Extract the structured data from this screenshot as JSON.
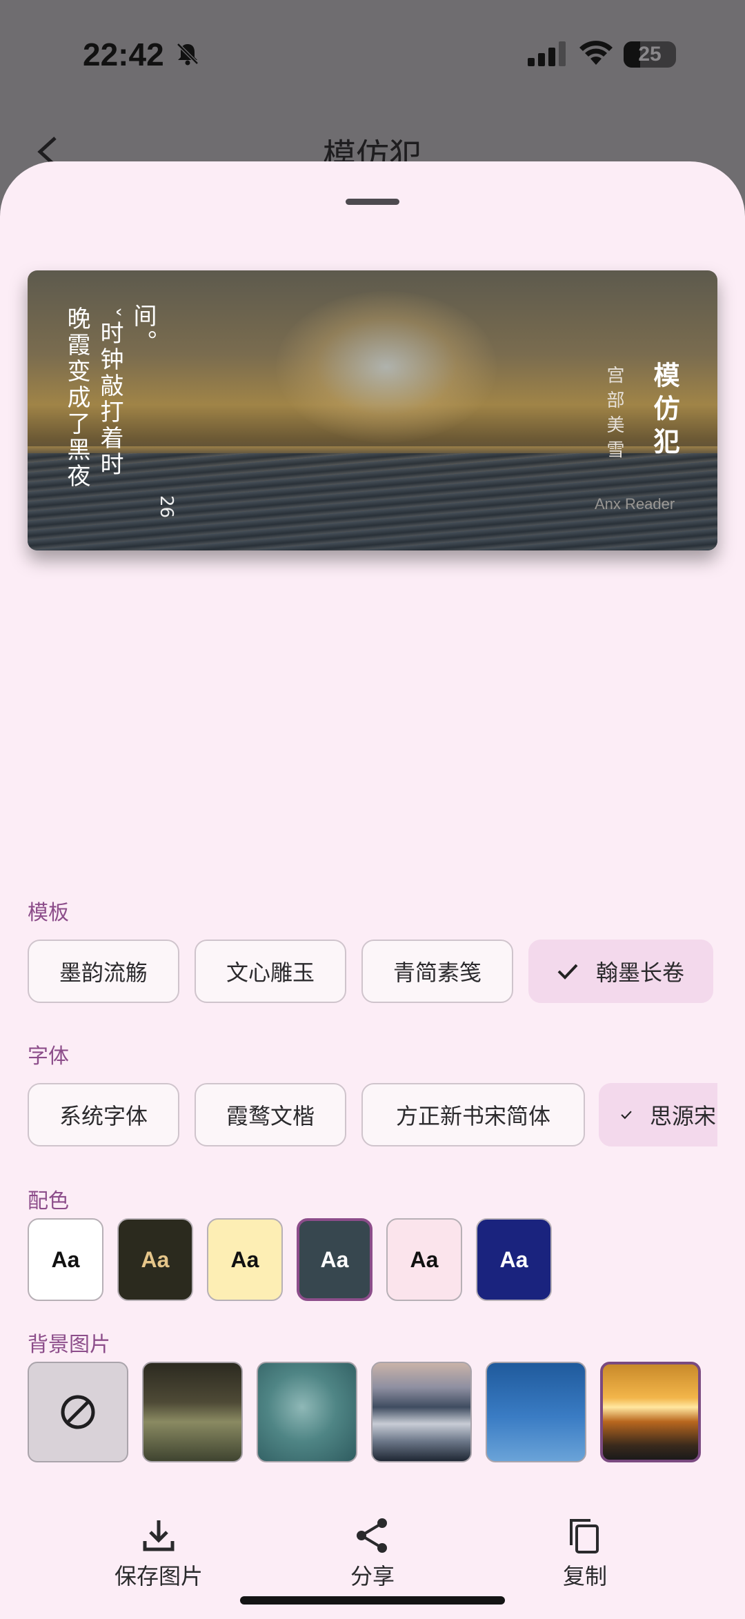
{
  "status_bar": {
    "time": "22:42",
    "battery": "25"
  },
  "background": {
    "title": "模仿犯"
  },
  "preview": {
    "poem_lines": [
      "间。",
      "ˇ时钟敲打着时",
      "晚霞变成了黑夜"
    ],
    "page_number": "26",
    "book_title": "模仿犯",
    "author": "宫部美雪",
    "watermark": "Anx Reader"
  },
  "sections": {
    "template_label": "模板",
    "font_label": "字体",
    "color_label": "配色",
    "bg_label": "背景图片"
  },
  "templates": [
    "墨韵流觞",
    "文心雕玉",
    "青简素笺",
    "翰墨长卷"
  ],
  "selected_template": "翰墨长卷",
  "fonts": [
    "系统字体",
    "霞鹜文楷",
    "方正新书宋简体",
    "思源宋"
  ],
  "selected_font": "思源宋",
  "color_schemes": [
    {
      "label": "Aa",
      "bg": "#ffffff",
      "fg": "#111111"
    },
    {
      "label": "Aa",
      "bg": "#2b2a1e",
      "fg": "#e6c68a"
    },
    {
      "label": "Aa",
      "bg": "#fdeeb4",
      "fg": "#111111"
    },
    {
      "label": "Aa",
      "bg": "#37474f",
      "fg": "#ffffff"
    },
    {
      "label": "Aa",
      "bg": "#fbe4ec",
      "fg": "#111111"
    },
    {
      "label": "Aa",
      "bg": "#1a237e",
      "fg": "#ffffff"
    }
  ],
  "selected_color_index": 3,
  "backgrounds": [
    "none",
    "marsh",
    "water-plants",
    "mountain-clouds",
    "blue-sky",
    "sunset-sea"
  ],
  "selected_background": "sunset-sea",
  "actions": {
    "save": "保存图片",
    "share": "分享",
    "copy": "复制"
  },
  "accent_color": "#8c4d8a"
}
